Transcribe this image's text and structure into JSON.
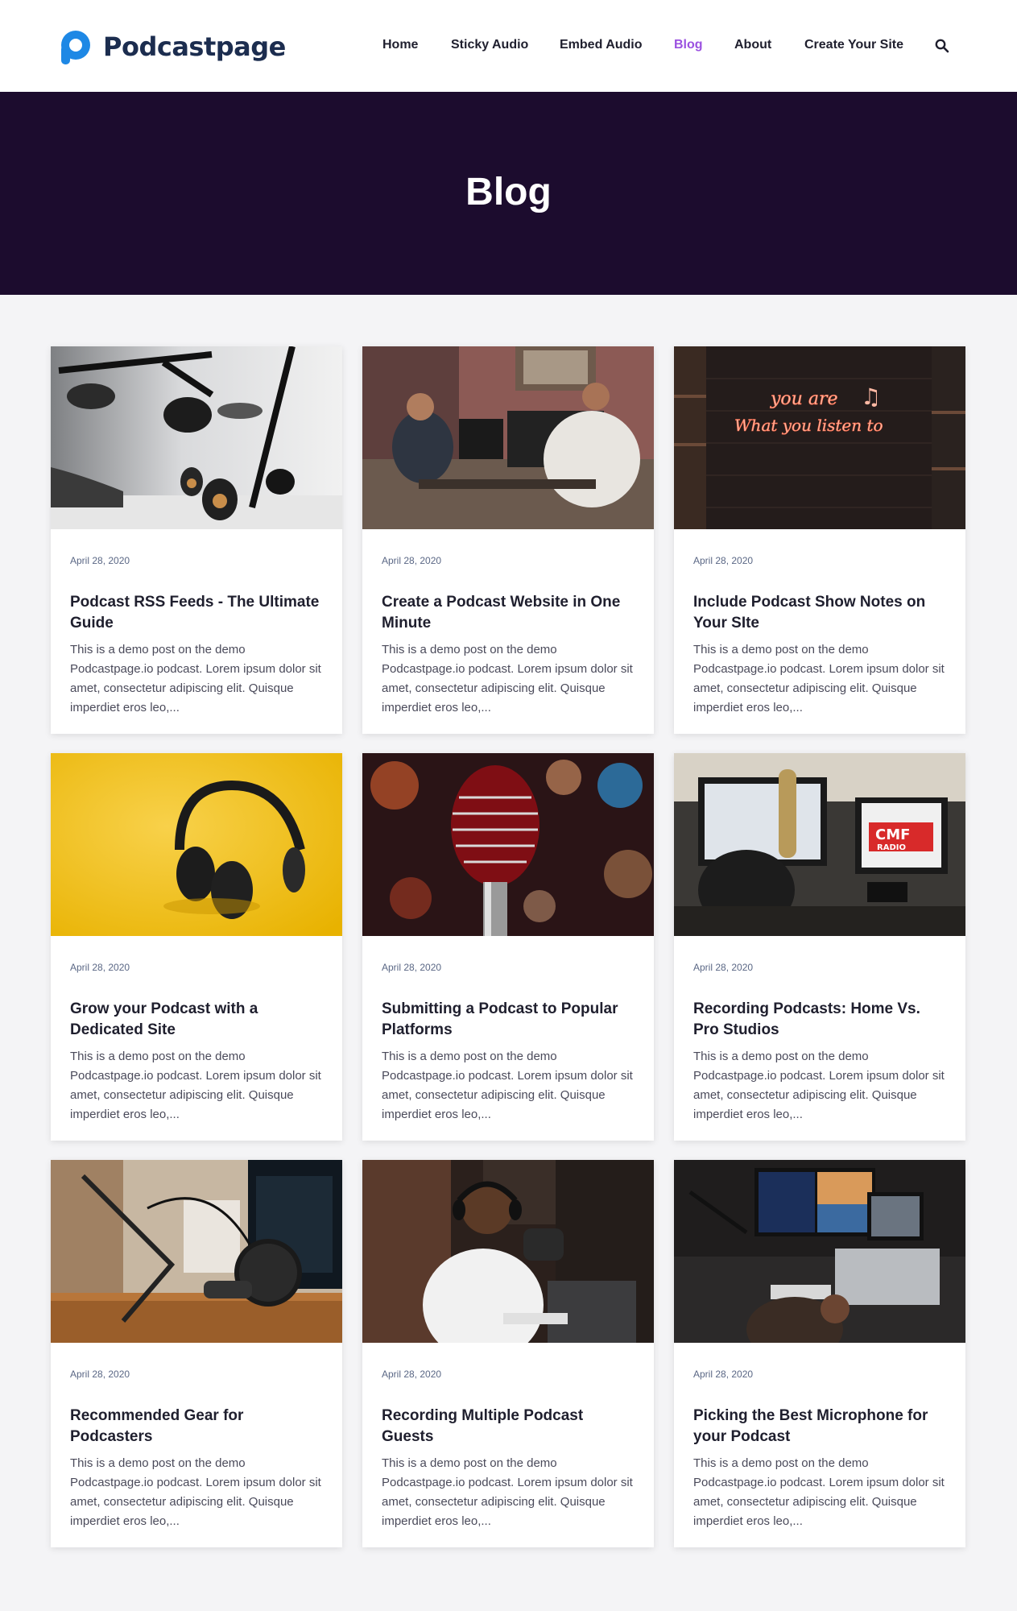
{
  "header": {
    "logo_text": "Podcastpage",
    "nav": [
      {
        "label": "Home"
      },
      {
        "label": "Sticky Audio"
      },
      {
        "label": "Embed Audio"
      },
      {
        "label": "Blog",
        "active": true
      },
      {
        "label": "About"
      },
      {
        "label": "Create Your Site"
      }
    ],
    "search_icon": "search-icon"
  },
  "hero": {
    "title": "Blog"
  },
  "colors": {
    "accent": "#9b51e0",
    "hero_bg": "#1c0c2e",
    "brand_blue": "#1e88e5",
    "logo_text": "#1c2d4f"
  },
  "posts": [
    {
      "date": "April 28, 2020",
      "title": "Podcast RSS Feeds - The Ultimate Guide",
      "excerpt": "This is a demo post on the demo Podcastpage.io podcast. Lorem ipsum dolor sit amet, consectetur adipiscing elit. Quisque imperdiet eros leo,..."
    },
    {
      "date": "April 28, 2020",
      "title": "Create a Podcast Website in One Minute",
      "excerpt": "This is a demo post on the demo Podcastpage.io podcast. Lorem ipsum dolor sit amet, consectetur adipiscing elit. Quisque imperdiet eros leo,..."
    },
    {
      "date": "April 28, 2020",
      "title": "Include Podcast Show Notes on Your SIte",
      "excerpt": "This is a demo post on the demo Podcastpage.io podcast. Lorem ipsum dolor sit amet, consectetur adipiscing elit. Quisque imperdiet eros leo,..."
    },
    {
      "date": "April 28, 2020",
      "title": "Grow your Podcast with a Dedicated Site",
      "excerpt": "This is a demo post on the demo Podcastpage.io podcast. Lorem ipsum dolor sit amet, consectetur adipiscing elit. Quisque imperdiet eros leo,..."
    },
    {
      "date": "April 28, 2020",
      "title": "Submitting a Podcast to Popular Platforms",
      "excerpt": "This is a demo post on the demo Podcastpage.io podcast. Lorem ipsum dolor sit amet, consectetur adipiscing elit. Quisque imperdiet eros leo,..."
    },
    {
      "date": "April 28, 2020",
      "title": "Recording Podcasts: Home Vs. Pro Studios",
      "excerpt": "This is a demo post on the demo Podcastpage.io podcast. Lorem ipsum dolor sit amet, consectetur adipiscing elit. Quisque imperdiet eros leo,..."
    },
    {
      "date": "April 28, 2020",
      "title": "Recommended Gear for Podcasters",
      "excerpt": "This is a demo post on the demo Podcastpage.io podcast. Lorem ipsum dolor sit amet, consectetur adipiscing elit. Quisque imperdiet eros leo,..."
    },
    {
      "date": "April 28, 2020",
      "title": "Recording Multiple Podcast Guests",
      "excerpt": "This is a demo post on the demo Podcastpage.io podcast. Lorem ipsum dolor sit amet, consectetur adipiscing elit. Quisque imperdiet eros leo,..."
    },
    {
      "date": "April 28, 2020",
      "title": "Picking the Best Microphone for your Podcast",
      "excerpt": "This is a demo post on the demo Podcastpage.io podcast. Lorem ipsum dolor sit amet, consectetur adipiscing elit. Quisque imperdiet eros leo,..."
    }
  ],
  "thumb_text": {
    "neon_line1": "you are",
    "neon_line2": "What you listen to",
    "radio_sign_line1": "CMF",
    "radio_sign_line2": "RADIO"
  }
}
